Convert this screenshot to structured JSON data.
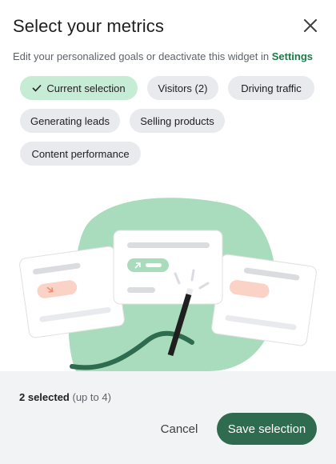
{
  "dialog": {
    "title": "Select your metrics",
    "subtitle_text": "Edit your personalized goals or deactivate this widget in",
    "subtitle_link": "Settings"
  },
  "chips": [
    {
      "label": "Current selection",
      "selected": true
    },
    {
      "label": "Visitors (2)",
      "selected": false
    },
    {
      "label": "Driving traffic",
      "selected": false
    },
    {
      "label": "Generating leads",
      "selected": false
    },
    {
      "label": "Selling products",
      "selected": false
    },
    {
      "label": "Content performance",
      "selected": false
    }
  ],
  "footer": {
    "selected_count": "2 selected",
    "limit_hint": "(up to 4)",
    "cancel_label": "Cancel",
    "save_label": "Save selection"
  },
  "colors": {
    "accent": "#2e6b4f",
    "selected_chip": "#c7ecd5",
    "chip": "#e8eaed",
    "blob": "#a8dcbc",
    "link": "#1e7a4a"
  },
  "icons": {
    "close": "close-icon",
    "check": "check-icon"
  }
}
